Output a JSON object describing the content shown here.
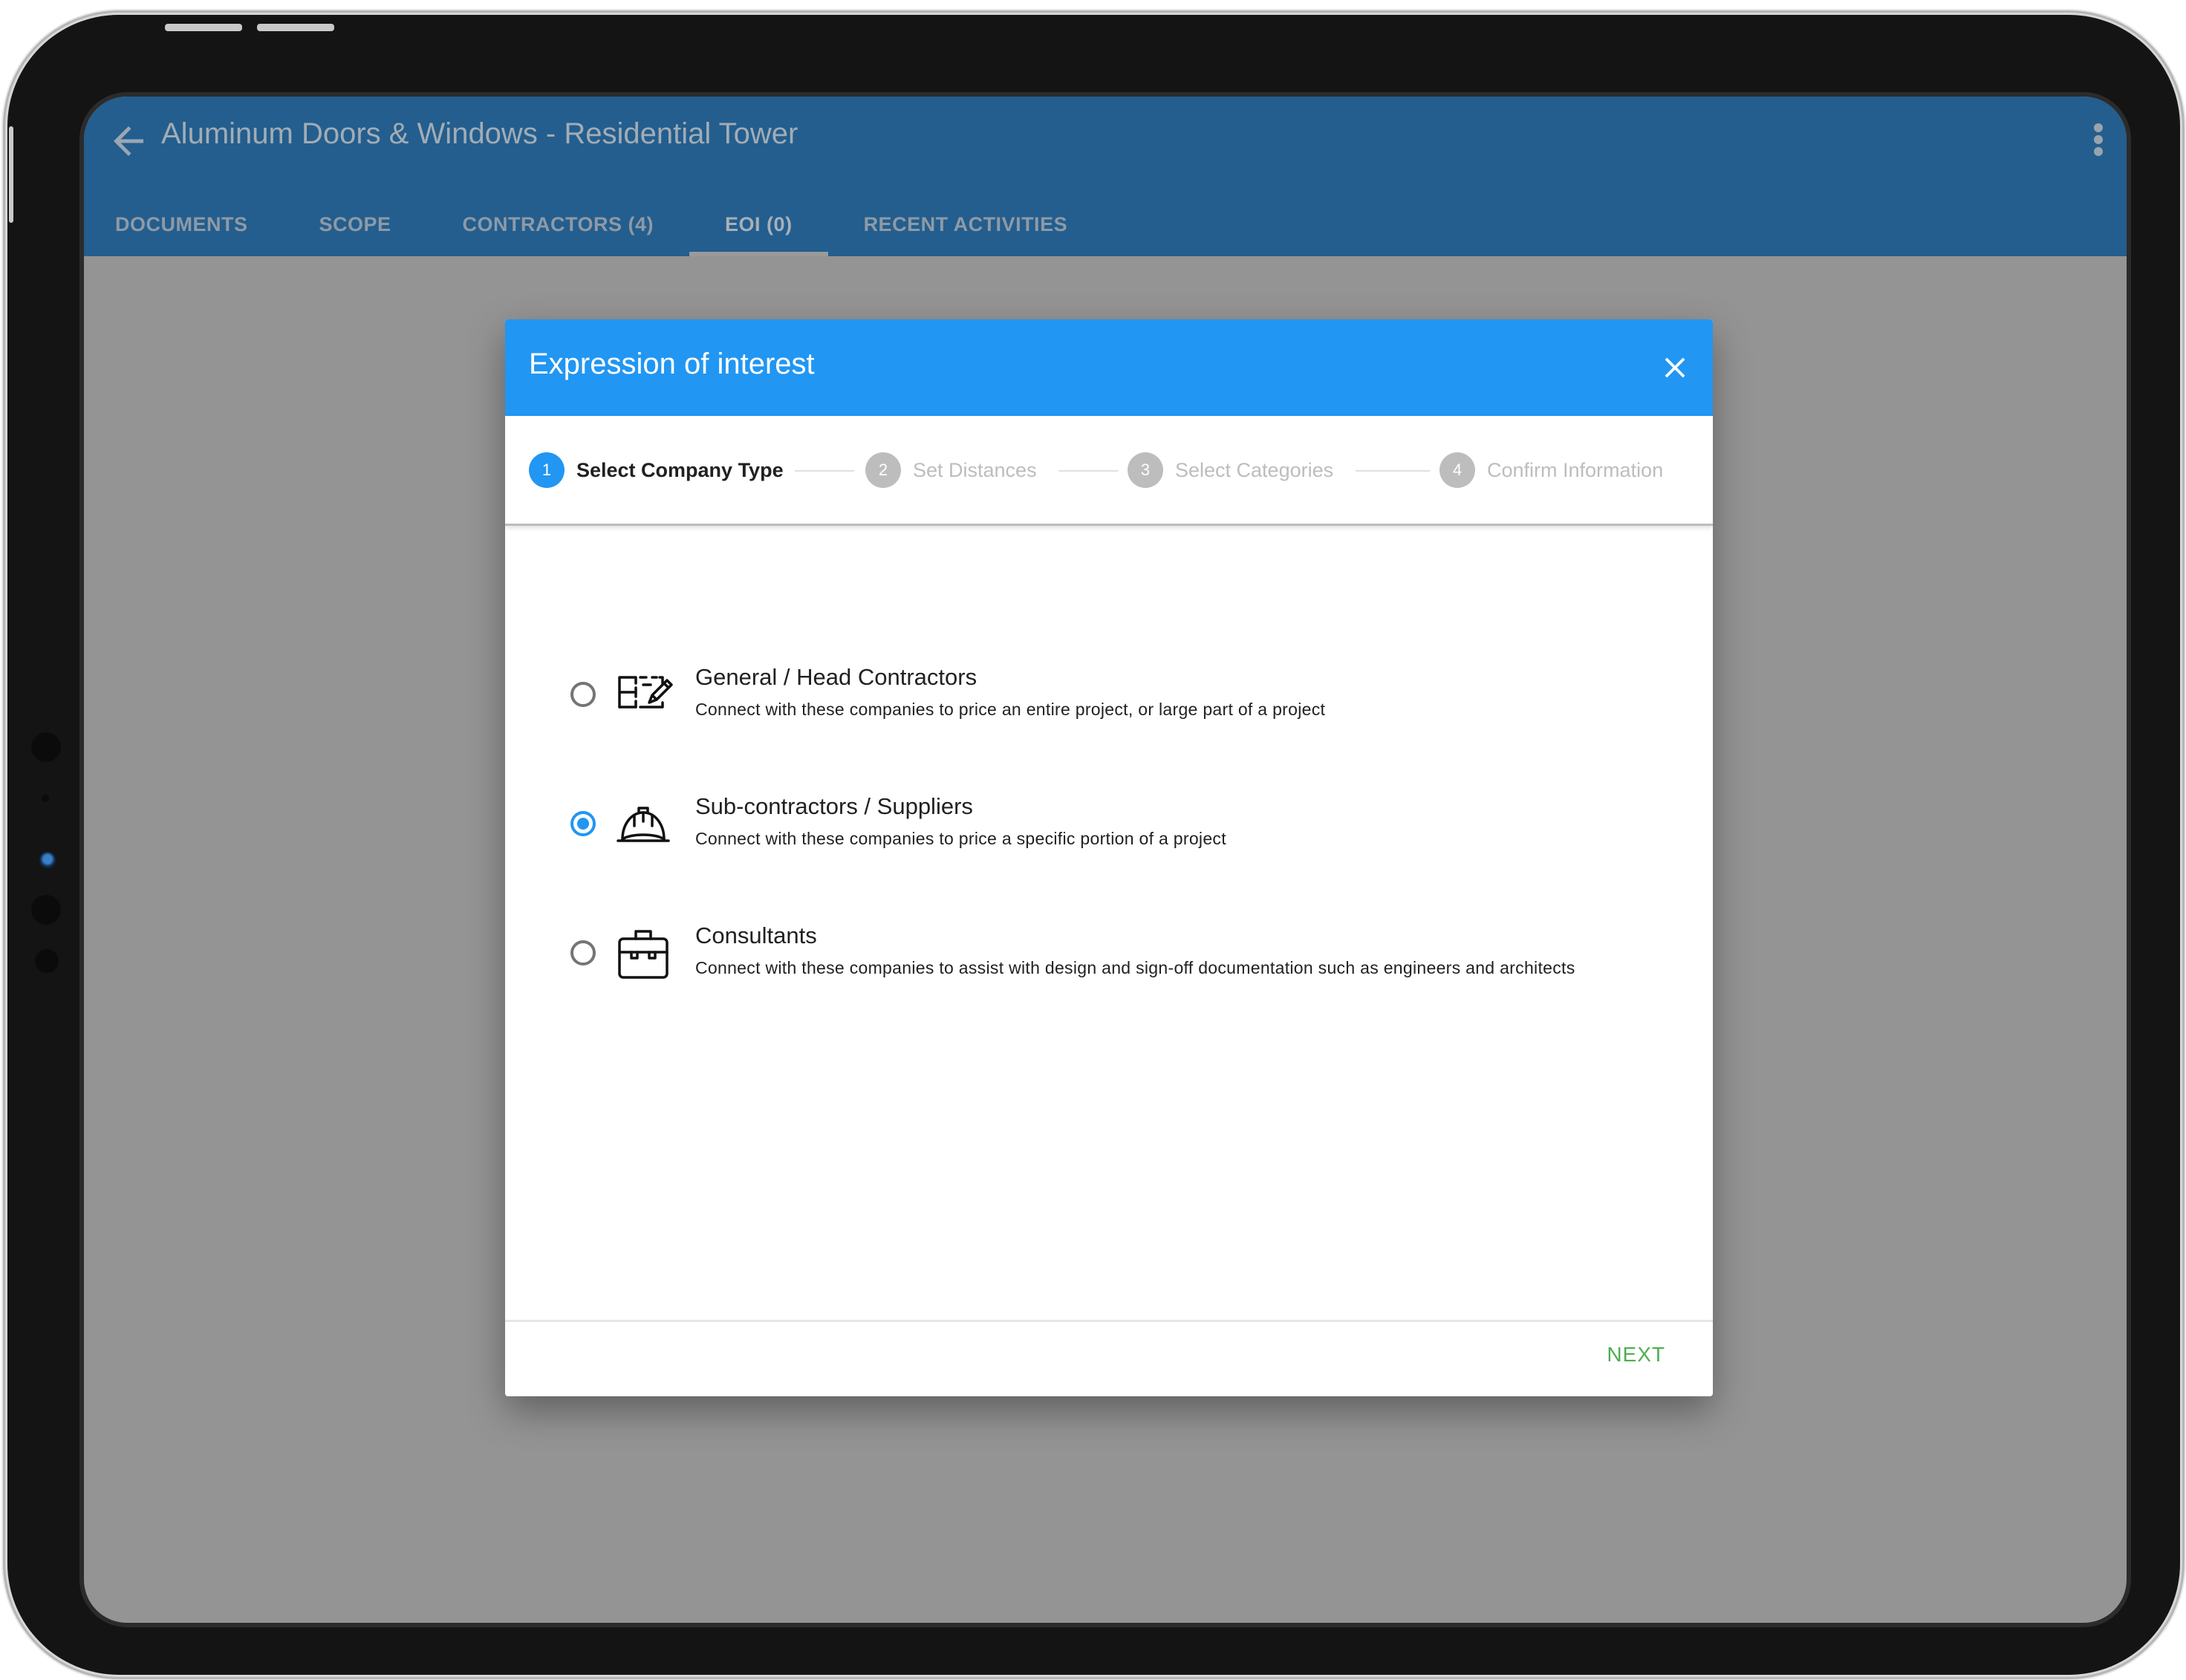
{
  "app_bar": {
    "back_icon": "arrow-left-icon",
    "title": "Aluminum Doors & Windows - Residential Tower",
    "more_icon": "more-vertical-icon"
  },
  "tabs": [
    {
      "label": "DOCUMENTS",
      "active": false
    },
    {
      "label": "SCOPE",
      "active": false
    },
    {
      "label": "CONTRACTORS (4)",
      "active": false
    },
    {
      "label": "EOI (0)",
      "active": true
    },
    {
      "label": "RECENT ACTIVITIES",
      "active": false
    }
  ],
  "dialog": {
    "title": "Expression of interest",
    "close_icon": "close-icon",
    "steps": [
      {
        "number": "1",
        "label": "Select Company Type",
        "active": true
      },
      {
        "number": "2",
        "label": "Set Distances",
        "active": false
      },
      {
        "number": "3",
        "label": "Select Categories",
        "active": false
      },
      {
        "number": "4",
        "label": "Confirm Information",
        "active": false
      }
    ],
    "options": [
      {
        "icon": "blueprint-edit-icon",
        "title": "General / Head Contractors",
        "description": "Connect with these companies to price an entire project, or large part of a project",
        "selected": false
      },
      {
        "icon": "hard-hat-icon",
        "title": "Sub-contractors / Suppliers",
        "description": "Connect with these companies to price a specific portion of a project",
        "selected": true
      },
      {
        "icon": "briefcase-icon",
        "title": "Consultants",
        "description": "Connect with these companies to assist with design and sign-off documentation such as engineers and architects",
        "selected": false
      }
    ],
    "next_label": "NEXT"
  },
  "colors": {
    "app_bar": "#235e8e",
    "dialog_header": "#2196f3",
    "step_active": "#2196f3",
    "step_inactive": "#bdbdbd",
    "radio_selected": "#2196f3",
    "next_button": "#4caf50",
    "scrim_background": "#949494"
  }
}
